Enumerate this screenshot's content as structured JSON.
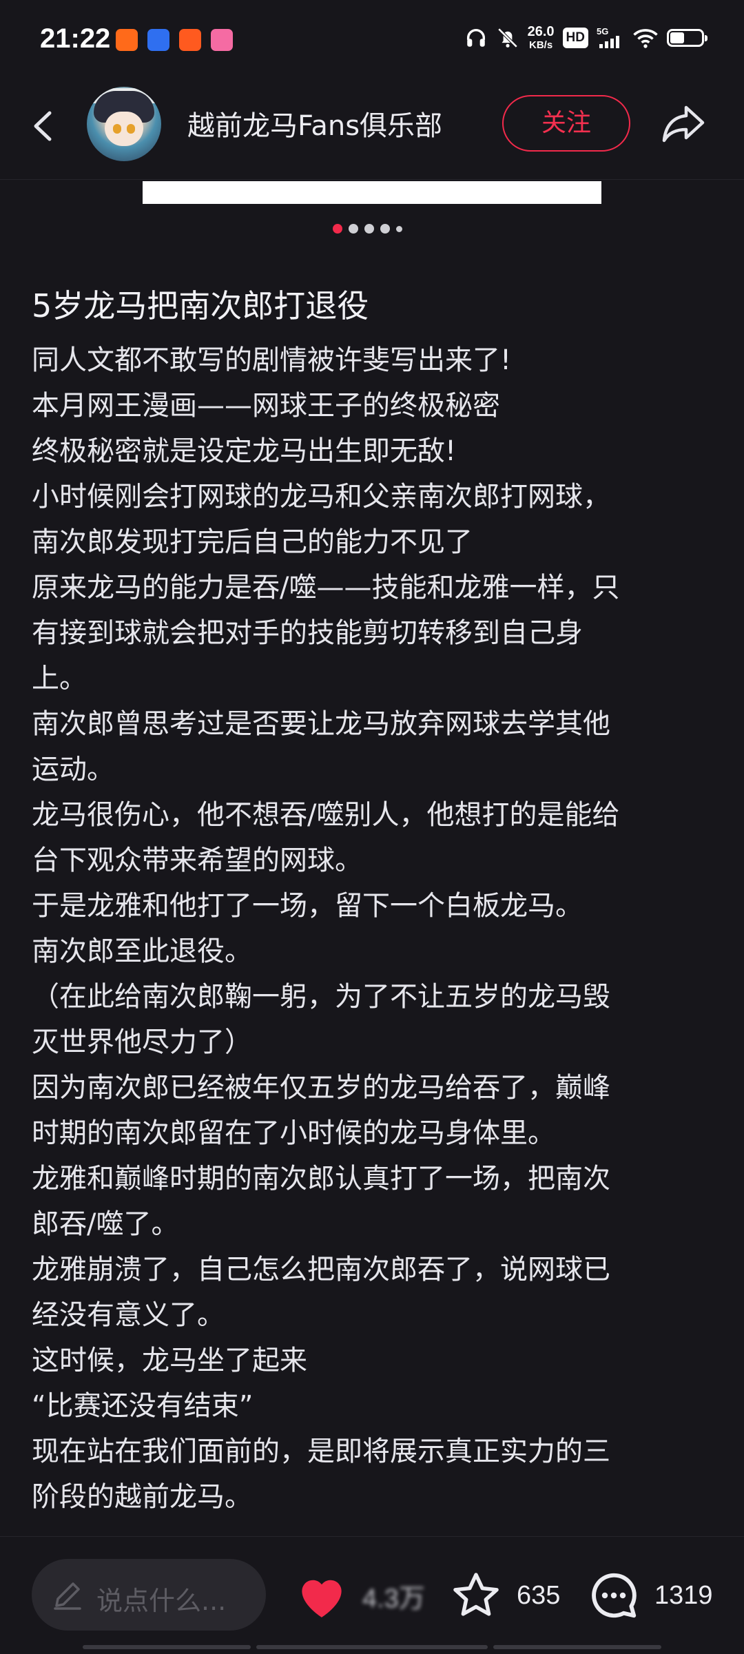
{
  "status_bar": {
    "time": "21:22",
    "app_icons": [
      {
        "name": "taobao-app-icon",
        "color": "#ff6a1a"
      },
      {
        "name": "baidu-netdisk-app-icon",
        "color": "#2f6ff0"
      },
      {
        "name": "kuaishou-app-icon",
        "color": "#ff5a1f"
      },
      {
        "name": "bilibili-app-icon",
        "color": "#f56ba3"
      }
    ],
    "net_speed": "26.0",
    "net_unit": "KB/s",
    "hd_label": "HD",
    "signal_label": "5G",
    "battery_level": 0.45
  },
  "header": {
    "title": "越前龙马Fans俱乐部",
    "follow_label": "关注"
  },
  "carousel": {
    "total": 5,
    "active_index": 0
  },
  "post": {
    "title": "5岁龙马把南次郎打退役",
    "lines": [
      "同人文都不敢写的剧情被许斐写出来了!",
      "本月网王漫画——网球王子的终极秘密",
      "终极秘密就是设定龙马出生即无敌!",
      "小时候刚会打网球的龙马和父亲南次郎打网球，",
      "南次郎发现打完后自己的能力不见了",
      "原来龙马的能力是吞/噬——技能和龙雅一样，只",
      "有接到球就会把对手的技能剪切转移到自己身",
      "上。",
      "南次郎曾思考过是否要让龙马放弃网球去学其他",
      "运动。",
      "龙马很伤心，他不想吞/噬别人，他想打的是能给",
      "台下观众带来希望的网球。",
      "于是龙雅和他打了一场，留下一个白板龙马。",
      "南次郎至此退役。",
      "（在此给南次郎鞠一躬，为了不让五岁的龙马毁",
      "灭世界他尽力了）",
      "因为南次郎已经被年仅五岁的龙马给吞了，巅峰",
      "时期的南次郎留在了小时候的龙马身体里。",
      "龙雅和巅峰时期的南次郎认真打了一场，把南次",
      "郎吞/噬了。",
      "龙雅崩溃了，自己怎么把南次郎吞了，说网球已",
      "经没有意义了。",
      "这时候，龙马坐了起来",
      "“比赛还没有结束”",
      "现在站在我们面前的，是即将展示真正实力的三",
      "阶段的越前龙马。"
    ]
  },
  "bottom_bar": {
    "comment_placeholder": "说点什么...",
    "like_count": "4.3万",
    "star_count": "635",
    "comment_count": "1319"
  },
  "colors": {
    "background": "#17161b",
    "accent": "#f22a4b",
    "text": "#e6e6ec"
  }
}
